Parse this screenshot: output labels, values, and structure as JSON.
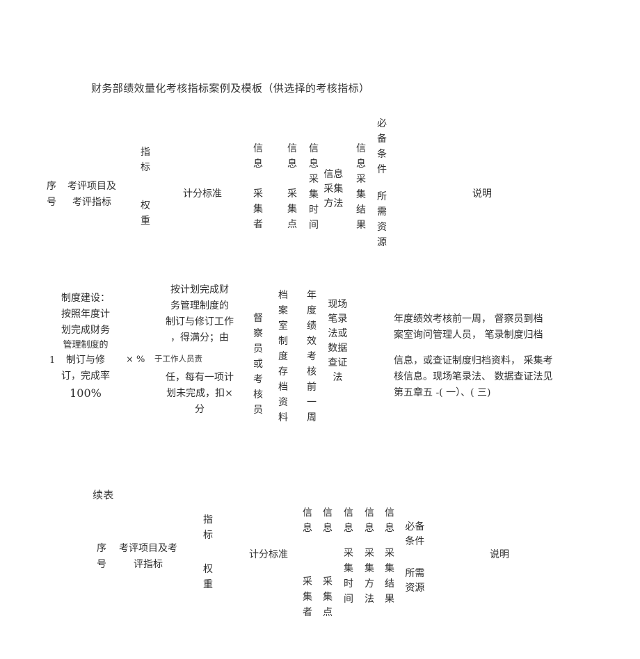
{
  "document": {
    "title": "财务部绩效量化考核指标案例及模板（供选择的考核指标）",
    "continuation_label": "续表"
  },
  "table1": {
    "headers": {
      "seq_no": "序号",
      "item_and_indicator": "考评项目及考评指标",
      "item_and_indicator_line1": "考评项目及",
      "item_and_indicator_line2": "考评指标",
      "seq_line1": "序",
      "seq_line2": "号",
      "indicator_weight": "指标权重",
      "indicator_weight_part1": "指标",
      "indicator_weight_part2": "权重",
      "scoring_standard": "计分标准",
      "info_collector": "信息采集者",
      "info_collector_part1": "信息",
      "info_collector_part2": "采集者",
      "info_collection_point": "信息采集点",
      "info_collection_point_part1": "信息",
      "info_collection_point_part2": "采集点",
      "info_collection_time": "信息采集时间",
      "info_collection_method": "信息采集方法",
      "info_collection_result": "信息采集结果",
      "required_conditions": "必备条件所需资源",
      "required_conditions_part1": "必备条件",
      "required_conditions_part2": "所需资源",
      "remarks": "说明"
    },
    "rows": [
      {
        "seq_no": "1",
        "item_and_indicator": "制度建设：按照年度计划完成财务管理制度的制订与修订，完成率100%",
        "item_lines": [
          "制度建设：",
          "按照年度计",
          "划完成财务",
          "管理制度的",
          "制订与修",
          "订，完成率",
          "100%"
        ],
        "indicator_weight": "×  %",
        "scoring_standard": "按计划完成财务管理制度的制订与修订工作，得满分；由于工作人员责任，每有一项计划未完成，扣×分",
        "scoring_lines": [
          "按计划完成财",
          "务管理制度的",
          "制订与修订工作",
          "，得满分；由"
        ],
        "scoring_inline": "于工作人员责",
        "scoring_lines2": [
          "任，每有一项计",
          "划未完成，扣×",
          "分"
        ],
        "info_collector": "督察员或考核员",
        "info_collection_point": "档案室制度存档资料",
        "info_collection_time": "年度绩效考核前一周",
        "info_collection_method": "现场笔录法或数据查证法",
        "info_collection_result": "",
        "required_conditions": "",
        "remarks": "年度绩效考核前一周， 督察员到档案室询问管理人员， 笔录制度归档信息，或查证制度归档资料， 采集考核信息。现场笔录法、 数据查证法见第五章五 -( 一）、( 三)",
        "remarks_para1": [
          "年度绩效考核前一周， 督察员到档",
          "案室询问管理人员， 笔录制度归档"
        ],
        "remarks_para2": [
          "信息，或查证制度归档资料， 采集考",
          "核信息。现场笔录法、 数据查证法见",
          "第五章五 -( 一）、( 三)"
        ]
      }
    ]
  },
  "table2": {
    "headers": {
      "seq_no": "序号",
      "seq_line1": "序",
      "seq_line2": "号",
      "item_and_indicator": "考评项目及考评指标",
      "item_line1": "考评项目及考",
      "item_line2": "评指标",
      "indicator_weight": "指标权重",
      "indicator_weight_part1": "指标",
      "indicator_weight_part2": "权重",
      "scoring_standard": "计分标准",
      "info_collector": "信息采集者",
      "info_collector_part1": "信息",
      "info_collector_part2": "采集者",
      "info_collection_point": "信息采集点",
      "info_collection_point_part1": "信息",
      "info_collection_point_part2": "采集点",
      "info_collection_time": "信息采集时间",
      "info_collection_time_part1": "信息",
      "info_collection_time_part2": "采集时间",
      "info_collection_method": "信息采集方法",
      "info_collection_method_part1": "信息",
      "info_collection_method_part2": "采集方法",
      "info_collection_result": "信息采集结果",
      "info_collection_result_part1": "信息",
      "info_collection_result_part2": "采集结果",
      "required_conditions": "必备条件所需资源",
      "required_conditions_part1": "必备条件",
      "required_conditions_part2": "所需资源",
      "remarks": "说明"
    },
    "rows": []
  },
  "colors": {
    "page_background": "#ffffff",
    "text": "#2f2f2f",
    "title_text": "#333333"
  }
}
